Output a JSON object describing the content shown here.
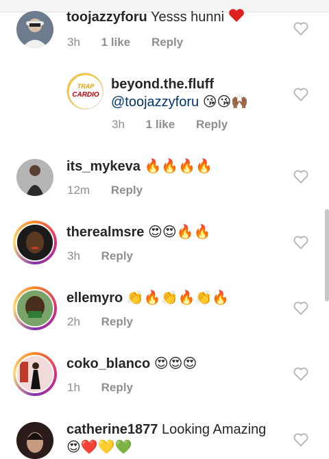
{
  "comments": [
    {
      "username": "toojazzyforu",
      "text": "Yesss hunni",
      "emoji": "❤️",
      "time": "3h",
      "likes": "1 like",
      "reply": "Reply"
    },
    {
      "username": "beyond.the.fluff",
      "mention": "@toojazzyforu",
      "emoji": "😘😘🙌🏾",
      "time": "3h",
      "likes": "1 like",
      "reply": "Reply",
      "avatar_text": [
        "TRAP",
        "CARDIO"
      ]
    },
    {
      "username": "its_mykeva",
      "emoji": "🔥🔥🔥🔥",
      "time": "12m",
      "reply": "Reply"
    },
    {
      "username": "therealmsre",
      "emoji": "😍😍🔥🔥",
      "time": "3h",
      "reply": "Reply"
    },
    {
      "username": "ellemyro",
      "emoji": "👏🔥👏🔥👏🔥",
      "time": "2h",
      "reply": "Reply"
    },
    {
      "username": "coko_blanco",
      "emoji": "😍😍😍",
      "time": "1h",
      "reply": "Reply"
    },
    {
      "username": "catherine1877",
      "text": "Looking Amazing",
      "emoji": "😍❤️💛💚"
    }
  ],
  "icons": {
    "like": "heart-outline-icon"
  },
  "colors": {
    "ring": "#dd2a7b",
    "mention": "#003569",
    "meta": "#8e8e8e",
    "heart": "#b8b8b8",
    "red_heart": "#e02020"
  }
}
